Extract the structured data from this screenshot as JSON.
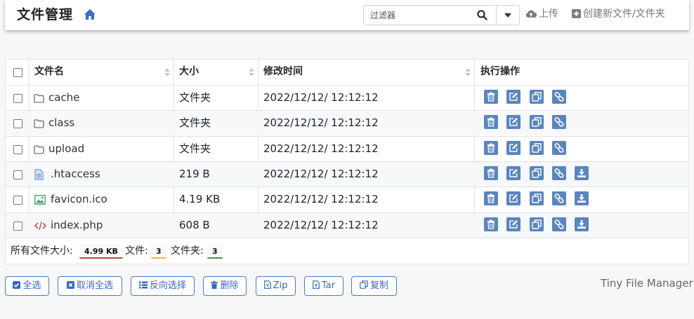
{
  "header": {
    "title": "文件管理",
    "search_placeholder": "过滤器",
    "upload_label": "上传",
    "create_label": "创建新文件/文件夹"
  },
  "table": {
    "columns": [
      "文件名",
      "大小",
      "修改时间",
      "执行操作"
    ],
    "rows": [
      {
        "name": "cache",
        "size": "文件夹",
        "modified": "2022/12/12/ 12:12:12",
        "icon": "folder-icon"
      },
      {
        "name": "class",
        "size": "文件夹",
        "modified": "2022/12/12/ 12:12:12",
        "icon": "folder-icon"
      },
      {
        "name": "upload",
        "size": "文件夹",
        "modified": "2022/12/12/ 12:12:12",
        "icon": "folder-icon"
      },
      {
        "name": ".htaccess",
        "size": "219 B",
        "modified": "2022/12/12/ 12:12:12",
        "icon": "file-text-icon"
      },
      {
        "name": "favicon.ico",
        "size": "4.19 KB",
        "modified": "2022/12/12/ 12:12:12",
        "icon": "image-file-icon"
      },
      {
        "name": "index.php",
        "size": "608 B",
        "modified": "2022/12/12/ 12:12:12",
        "icon": "code-file-icon"
      }
    ],
    "actions": [
      "delete-icon",
      "edit-icon",
      "copy-icon",
      "link-icon",
      "download-icon"
    ]
  },
  "summary": {
    "total_size_label": "所有文件大小:",
    "total_size": "4.99 KB",
    "files_label": "文件:",
    "files_count": "3",
    "folders_label": "文件夹:",
    "folders_count": "3"
  },
  "buttons": {
    "select_all": "全选",
    "deselect_all": "取消全选",
    "invert_selection": "反向选择",
    "delete": "删除",
    "zip": "Zip",
    "tar": "Tar",
    "copy": "复制"
  },
  "credit": "Tiny File Manager",
  "colors": {
    "accent": "#5a85be",
    "button_border": "#4d79c7",
    "badge_size": "#b3522c",
    "badge_files": "#e8b830",
    "badge_folders": "#3c9a46"
  }
}
